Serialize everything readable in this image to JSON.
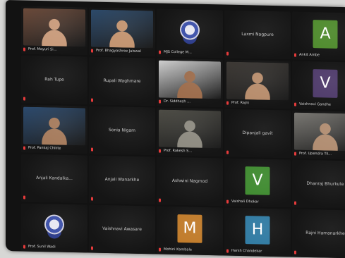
{
  "participants": [
    {
      "label": "Prof. Mayuri Si...",
      "kind": "video",
      "bg": "#6b4a3a",
      "skin": "#c89a7a"
    },
    {
      "label": "Prof. Bhagyashree Jaiswal",
      "kind": "video",
      "bg": "#2d4a6a",
      "skin": "#c2936f"
    },
    {
      "label": "MJS College M...",
      "kind": "logo"
    },
    {
      "label": "Laxmi Nagpure",
      "kind": "name"
    },
    {
      "label": "Ankit Ambe",
      "kind": "avatar",
      "letter": "A",
      "color": "#4e8a2c"
    },
    {
      "label": "Rah Tupe",
      "kind": "name"
    },
    {
      "label": "Rupali Waghmare",
      "kind": "name"
    },
    {
      "label": "Dr. Siddhesh ...",
      "kind": "video",
      "bg": "#cfcfcf",
      "skin": "#9c6b4a"
    },
    {
      "label": "Prof. Rajni",
      "kind": "video",
      "bg": "#3e3a36",
      "skin": "#b78c6b"
    },
    {
      "label": "Vaishnavi Gandhe",
      "kind": "avatar",
      "letter": "V",
      "color": "#4e3a6a"
    },
    {
      "label": "Prof. Pankaj Chikte",
      "kind": "video",
      "bg": "#2c4a6d",
      "skin": "#a57a5b"
    },
    {
      "label": "Sonia Nigam",
      "kind": "name"
    },
    {
      "label": "Prof. Rakesh S...",
      "kind": "video",
      "bg": "#4e4d46",
      "skin": "#8d8a80"
    },
    {
      "label": "Dipanjali gavit",
      "kind": "name"
    },
    {
      "label": "Prof. Upendra Til...",
      "kind": "video",
      "bg": "#7a7873",
      "skin": "#b08c70"
    },
    {
      "label": "Anjali Kandalka...",
      "kind": "name"
    },
    {
      "label": "Anjali Wanarkhe",
      "kind": "name"
    },
    {
      "label": "Ashwini Nagmod",
      "kind": "name"
    },
    {
      "label": "Vaishali Dhokar",
      "kind": "avatar",
      "letter": "V",
      "color": "#3e8a2f"
    },
    {
      "label": "Dhanraj Bhurkute",
      "kind": "name"
    },
    {
      "label": "Prof. Sunil Wadi",
      "kind": "logo"
    },
    {
      "label": "Vaishnavi Awasare",
      "kind": "name"
    },
    {
      "label": "Mohini Kambale",
      "kind": "avatar",
      "letter": "M",
      "color": "#c07a28"
    },
    {
      "label": "Harsh Chandekar",
      "kind": "avatar",
      "letter": "H",
      "color": "#2f7aa2"
    },
    {
      "label": "Rajni Hamanarkhe",
      "kind": "name"
    }
  ]
}
